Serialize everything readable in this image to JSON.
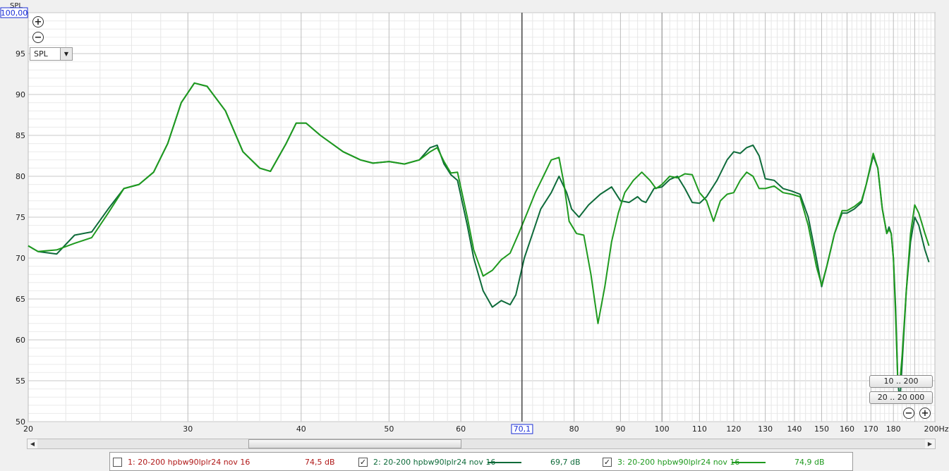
{
  "chart_data": {
    "type": "line",
    "x_scale": "log",
    "xlim": [
      20,
      200
    ],
    "ylim": [
      50,
      100
    ],
    "y_ticks": [
      50,
      55,
      60,
      65,
      70,
      75,
      80,
      85,
      90,
      95
    ],
    "y_top_label": "100,00",
    "ylabel": "SPL",
    "x_ticks": [
      {
        "v": 20,
        "label": "20"
      },
      {
        "v": 30,
        "label": "30"
      },
      {
        "v": 40,
        "label": "40"
      },
      {
        "v": 50,
        "label": "50"
      },
      {
        "v": 60,
        "label": "60"
      },
      {
        "v": 80,
        "label": "80"
      },
      {
        "v": 90,
        "label": "90"
      },
      {
        "v": 100,
        "label": "100"
      },
      {
        "v": 110,
        "label": "110"
      },
      {
        "v": 120,
        "label": "120"
      },
      {
        "v": 130,
        "label": "130"
      },
      {
        "v": 140,
        "label": "140"
      },
      {
        "v": 150,
        "label": "150"
      },
      {
        "v": 160,
        "label": "160"
      },
      {
        "v": 170,
        "label": "170"
      },
      {
        "v": 180,
        "label": "180"
      }
    ],
    "x_unit": "200Hz",
    "cursor": {
      "x": 70.1,
      "label": "70,1"
    },
    "grid": true,
    "series": [
      {
        "name": "2: 20-200 hpbw90lplr24 nov 16",
        "color": "#0e6b3a",
        "points": [
          [
            20,
            71.5
          ],
          [
            20.5,
            70.8
          ],
          [
            21.5,
            70.5
          ],
          [
            22.5,
            72.8
          ],
          [
            23.5,
            73.2
          ],
          [
            24.5,
            76
          ],
          [
            25.5,
            78.5
          ],
          [
            26.5,
            79
          ],
          [
            27.5,
            80.5
          ],
          [
            28.5,
            84
          ],
          [
            29.5,
            89
          ],
          [
            30.5,
            91.4
          ],
          [
            31.5,
            91
          ],
          [
            33,
            88
          ],
          [
            34.5,
            83
          ],
          [
            36,
            81
          ],
          [
            37,
            80.6
          ],
          [
            38.5,
            84
          ],
          [
            39.5,
            86.5
          ],
          [
            40.5,
            86.5
          ],
          [
            42,
            85
          ],
          [
            44.5,
            83
          ],
          [
            46.5,
            82
          ],
          [
            48,
            81.6
          ],
          [
            50,
            81.8
          ],
          [
            52,
            81.5
          ],
          [
            54,
            82
          ],
          [
            55.5,
            83.5
          ],
          [
            56.5,
            83.8
          ],
          [
            57.5,
            81.5
          ],
          [
            58.5,
            80.2
          ],
          [
            59.5,
            79.5
          ],
          [
            61,
            74
          ],
          [
            62,
            70
          ],
          [
            63.5,
            66
          ],
          [
            65,
            64
          ],
          [
            66.5,
            64.8
          ],
          [
            68,
            64.3
          ],
          [
            69,
            65.5
          ],
          [
            70.5,
            70
          ],
          [
            72,
            73
          ],
          [
            73.5,
            76
          ],
          [
            75.5,
            78
          ],
          [
            77,
            80
          ],
          [
            78.5,
            78
          ],
          [
            79.5,
            76
          ],
          [
            81,
            75
          ],
          [
            83,
            76.5
          ],
          [
            85.5,
            77.8
          ],
          [
            88,
            78.7
          ],
          [
            90,
            77
          ],
          [
            92,
            76.8
          ],
          [
            94,
            77.5
          ],
          [
            95,
            77
          ],
          [
            96,
            76.8
          ],
          [
            98,
            78.5
          ],
          [
            100,
            78.7
          ],
          [
            102,
            79.6
          ],
          [
            104,
            80
          ],
          [
            106,
            78.5
          ],
          [
            108,
            76.8
          ],
          [
            110,
            76.7
          ],
          [
            112,
            77.5
          ],
          [
            115,
            79.5
          ],
          [
            118,
            82
          ],
          [
            120,
            83
          ],
          [
            122,
            82.8
          ],
          [
            124,
            83.5
          ],
          [
            126,
            83.8
          ],
          [
            128,
            82.5
          ],
          [
            130,
            79.7
          ],
          [
            133,
            79.5
          ],
          [
            136,
            78.5
          ],
          [
            139,
            78.2
          ],
          [
            142,
            77.8
          ],
          [
            145,
            75
          ],
          [
            148,
            70
          ],
          [
            150,
            66.5
          ],
          [
            152,
            69
          ],
          [
            155,
            73
          ],
          [
            158,
            75.5
          ],
          [
            160,
            75.5
          ],
          [
            163,
            76
          ],
          [
            166,
            76.8
          ],
          [
            168,
            79
          ],
          [
            171,
            82.5
          ],
          [
            173,
            81
          ],
          [
            175,
            76
          ],
          [
            177,
            73
          ],
          [
            178,
            73.8
          ],
          [
            179,
            73
          ],
          [
            180,
            70
          ],
          [
            181,
            64
          ],
          [
            182,
            55
          ],
          [
            183,
            52.5
          ],
          [
            184,
            57
          ],
          [
            186,
            66
          ],
          [
            188,
            72
          ],
          [
            190,
            75
          ],
          [
            192,
            74
          ],
          [
            195,
            71
          ],
          [
            197,
            69.5
          ]
        ]
      },
      {
        "name": "3: 20-200 hpbw90lplr24 nov 16",
        "color": "#1f9a1f",
        "points": [
          [
            20,
            71.5
          ],
          [
            20.5,
            70.8
          ],
          [
            21.5,
            71
          ],
          [
            22.5,
            71.8
          ],
          [
            23.5,
            72.5
          ],
          [
            24.5,
            75.5
          ],
          [
            25.5,
            78.5
          ],
          [
            26.5,
            79
          ],
          [
            27.5,
            80.5
          ],
          [
            28.5,
            84
          ],
          [
            29.5,
            89
          ],
          [
            30.5,
            91.4
          ],
          [
            31.5,
            91
          ],
          [
            33,
            88
          ],
          [
            34.5,
            83
          ],
          [
            36,
            81
          ],
          [
            37,
            80.6
          ],
          [
            38.5,
            84
          ],
          [
            39.5,
            86.5
          ],
          [
            40.5,
            86.5
          ],
          [
            42,
            85
          ],
          [
            44.5,
            83
          ],
          [
            46.5,
            82
          ],
          [
            48,
            81.6
          ],
          [
            50,
            81.8
          ],
          [
            52,
            81.5
          ],
          [
            54,
            82
          ],
          [
            55.5,
            83
          ],
          [
            56.5,
            83.5
          ],
          [
            57.5,
            81.8
          ],
          [
            58.5,
            80.4
          ],
          [
            59.5,
            80.5
          ],
          [
            61,
            75
          ],
          [
            62,
            71
          ],
          [
            63.5,
            67.8
          ],
          [
            65,
            68.5
          ],
          [
            66.5,
            69.8
          ],
          [
            68,
            70.6
          ],
          [
            69.5,
            73
          ],
          [
            71,
            75.5
          ],
          [
            72.5,
            78
          ],
          [
            74,
            80
          ],
          [
            75.5,
            82
          ],
          [
            77,
            82.3
          ],
          [
            78,
            79
          ],
          [
            79,
            74.5
          ],
          [
            80.5,
            73
          ],
          [
            82,
            72.8
          ],
          [
            83.5,
            68
          ],
          [
            85,
            62
          ],
          [
            86.5,
            66.5
          ],
          [
            88,
            72
          ],
          [
            89.5,
            75.5
          ],
          [
            91,
            78
          ],
          [
            93,
            79.5
          ],
          [
            95,
            80.5
          ],
          [
            97,
            79.5
          ],
          [
            98.5,
            78.5
          ],
          [
            100,
            79
          ],
          [
            102,
            80
          ],
          [
            104,
            79.8
          ],
          [
            106,
            80.3
          ],
          [
            108,
            80.2
          ],
          [
            110,
            78
          ],
          [
            112,
            77
          ],
          [
            114,
            74.5
          ],
          [
            116,
            77
          ],
          [
            118,
            77.8
          ],
          [
            120,
            78
          ],
          [
            122,
            79.5
          ],
          [
            124,
            80.5
          ],
          [
            126,
            80
          ],
          [
            128,
            78.5
          ],
          [
            130,
            78.5
          ],
          [
            133,
            78.8
          ],
          [
            136,
            78
          ],
          [
            139,
            77.8
          ],
          [
            142,
            77.5
          ],
          [
            145,
            74
          ],
          [
            148,
            69
          ],
          [
            150,
            66.7
          ],
          [
            152,
            69
          ],
          [
            155,
            73
          ],
          [
            158,
            75.8
          ],
          [
            160,
            75.8
          ],
          [
            163,
            76.3
          ],
          [
            166,
            77
          ],
          [
            168,
            79
          ],
          [
            171,
            82.8
          ],
          [
            173,
            81
          ],
          [
            175,
            76
          ],
          [
            177,
            73
          ],
          [
            178,
            73.5
          ],
          [
            179,
            73
          ],
          [
            180,
            70
          ],
          [
            181,
            63
          ],
          [
            182,
            55
          ],
          [
            183,
            54.8
          ],
          [
            184,
            58
          ],
          [
            186,
            66
          ],
          [
            188,
            73
          ],
          [
            190,
            76.5
          ],
          [
            192,
            75.5
          ],
          [
            195,
            73
          ],
          [
            197,
            71.5
          ]
        ]
      }
    ]
  },
  "controls": {
    "zoom_in_symbol": "+",
    "zoom_out_symbol": "−",
    "spl_select_value": "SPL",
    "range_10_200": "10 .. 200",
    "range_20_20000": "20 .. 20 000"
  },
  "legend": {
    "items": [
      {
        "name": "1: 20-200 hpbw90lplr24 nov 16",
        "value": "74,5 dB",
        "checked": false,
        "color": "#b01818"
      },
      {
        "name": "2: 20-200 hpbw90lplr24 nov 16",
        "value": "69,7 dB",
        "checked": true,
        "color": "#0e6b3a"
      },
      {
        "name": "3: 20-200 hpbw90lplr24 nov 16",
        "value": "74,9 dB",
        "checked": true,
        "color": "#1f9a1f"
      }
    ]
  }
}
